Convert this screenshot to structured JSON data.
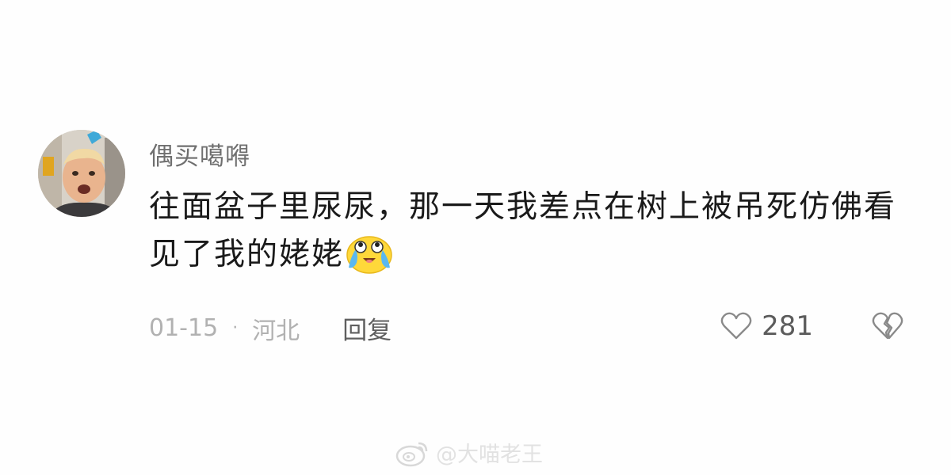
{
  "comment": {
    "username": "偶买噶嘚",
    "text": "往面盆子里尿尿，那一天我差点在树上被吊死仿佛看见了我的姥姥",
    "emoji": "crying-laughing-emoji",
    "date": "01-15",
    "separator": "·",
    "location": "河北",
    "reply_label": "回复",
    "like_count": "281",
    "like_icon": "heart-outline-icon",
    "dislike_icon": "broken-heart-icon"
  },
  "watermark": {
    "text": "@大喵老王",
    "logo": "weibo-logo"
  },
  "colors": {
    "background": "#fefefe",
    "text": "#1a1a1a",
    "username": "#6f6f6f",
    "meta": "#b1b1b1",
    "reply": "#5f5f5f"
  }
}
